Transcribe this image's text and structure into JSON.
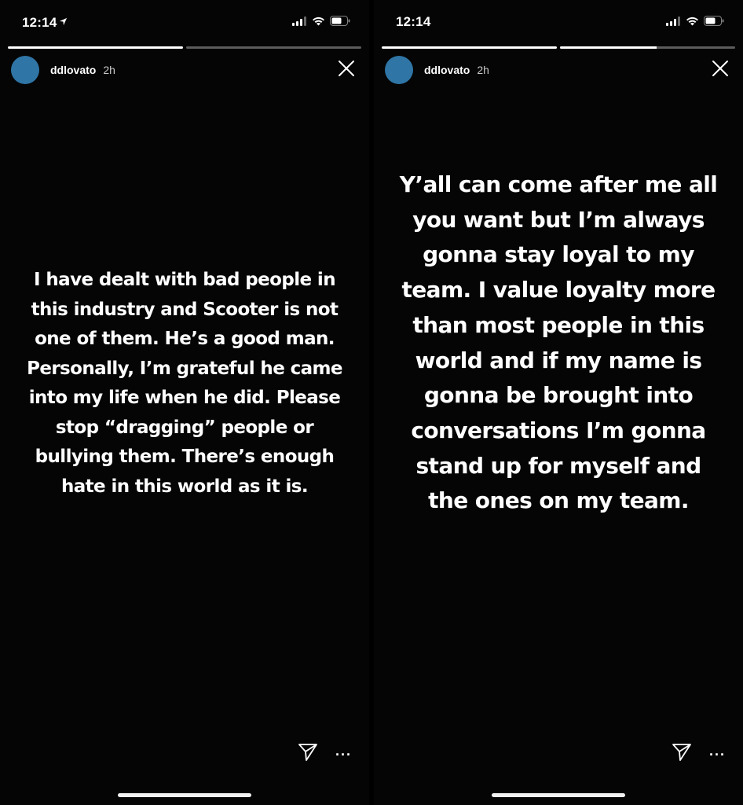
{
  "stories": [
    {
      "status": {
        "time": "12:14",
        "show_location_arrow": true
      },
      "progress": [
        1.0,
        0.0
      ],
      "header": {
        "username": "ddlovato",
        "age": "2h",
        "avatar_color": "#2f75a5"
      },
      "text_lines": [
        "I have dealt with bad people in",
        "this industry and Scooter is not",
        "one of them. He’s a good man.",
        "Personally, I’m grateful he came",
        "into my life when he did.  Please",
        "stop “dragging” people or",
        "bullying them. There’s enough",
        "hate in this world as it is."
      ],
      "actions": {
        "send_icon": "send-icon",
        "more_label": "···"
      }
    },
    {
      "status": {
        "time": "12:14",
        "show_location_arrow": false
      },
      "progress": [
        1.0,
        0.55
      ],
      "header": {
        "username": "ddlovato",
        "age": "2h",
        "avatar_color": "#2f75a5"
      },
      "text_lines": [
        "Y’all can come after me all",
        "you want but I’m always",
        "gonna stay loyal to my",
        "team. I value loyalty more",
        "than most people in this",
        "world and if my name is",
        "gonna be brought into",
        "conversations I’m gonna",
        "stand up for myself and",
        "the ones on my team."
      ],
      "actions": {
        "send_icon": "send-icon",
        "more_label": "···"
      }
    }
  ],
  "colors": {
    "background": "#050505",
    "text": "#ffffff",
    "progress_track": "rgba(255,255,255,0.35)",
    "progress_fill": "#ffffff"
  }
}
